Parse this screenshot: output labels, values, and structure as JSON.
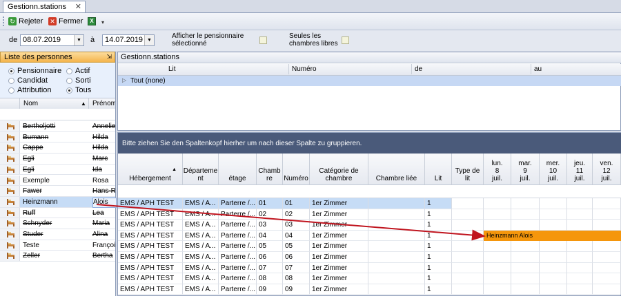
{
  "tab": {
    "title": "Gestionn.stations"
  },
  "toolbar": {
    "reject_label": "Rejeter",
    "close_label": "Fermer"
  },
  "filter": {
    "from_label": "de",
    "from_date": "08.07.2019",
    "to_label": "à",
    "to_date": "14.07.2019",
    "show_selected_label_1": "Afficher le pensionnaire",
    "show_selected_label_2": "sélectionné",
    "free_rooms_label_1": "Seules les",
    "free_rooms_label_2": "chambres libres"
  },
  "persons_panel": {
    "title": "Liste des personnes",
    "radios": [
      {
        "label": "Pensionnaire",
        "checked": true
      },
      {
        "label": "Actif",
        "checked": false
      },
      {
        "label": "Candidat",
        "checked": false
      },
      {
        "label": "Sorti",
        "checked": false
      },
      {
        "label": "Attribution",
        "checked": false
      },
      {
        "label": "Tous",
        "checked": true
      }
    ],
    "col_name": "Nom",
    "col_first": "Prénom",
    "rows": [
      {
        "name": "Bertholjotti",
        "first": "Anneliese",
        "struck": true
      },
      {
        "name": "Bumann",
        "first": "Hilda",
        "struck": true
      },
      {
        "name": "Cappe",
        "first": "Hilda",
        "struck": true
      },
      {
        "name": "Egli",
        "first": "Marc",
        "struck": true
      },
      {
        "name": "Egli",
        "first": "Ida",
        "struck": true
      },
      {
        "name": "Exemple",
        "first": "Rosa",
        "struck": false
      },
      {
        "name": "Fawer",
        "first": "Hans-Rudolf",
        "struck": true
      },
      {
        "name": "Heinzmann",
        "first": "Alois",
        "struck": false,
        "selected": true
      },
      {
        "name": "Ruff",
        "first": "Lea",
        "struck": true
      },
      {
        "name": "Schnyder",
        "first": "Maria",
        "struck": true
      },
      {
        "name": "Studer",
        "first": "Alina",
        "struck": true
      },
      {
        "name": "Teste",
        "first": "François",
        "struck": false
      },
      {
        "name": "Zeller",
        "first": "Bertha",
        "struck": true
      }
    ]
  },
  "stations_top": {
    "title": "Gestionn.stations",
    "cols": [
      "Lit",
      "Numéro",
      "de",
      "au"
    ],
    "group_row": "Tout  (none)"
  },
  "grid": {
    "group_hint": "Bitte ziehen Sie den Spaltenkopf hierher um nach dieser Spalte zu gruppieren.",
    "headers": [
      "Hébergement",
      "Départeme\nnt",
      "étage",
      "Chamb\nre",
      "Numéro",
      "Catégorie de\nchambre",
      "Chambre liée",
      "Lit",
      "Type de\nlit",
      "lun.\n8\njuil.",
      "mar.\n9\njuil.",
      "mer.\n10\njuil.",
      "jeu.\n11\njuil.",
      "ven.\n12\njuil."
    ],
    "rows": [
      [
        "EMS / APH TEST",
        "EMS / A...",
        "Parterre /...",
        "01",
        "01",
        "1er Zimmer",
        "",
        "1"
      ],
      [
        "EMS / APH TEST",
        "EMS / A...",
        "Parterre /...",
        "02",
        "02",
        "1er Zimmer",
        "",
        "1"
      ],
      [
        "EMS / APH TEST",
        "EMS / A...",
        "Parterre /...",
        "03",
        "03",
        "1er Zimmer",
        "",
        "1"
      ],
      [
        "EMS / APH TEST",
        "EMS / A...",
        "Parterre /...",
        "04",
        "04",
        "1er Zimmer",
        "",
        "1"
      ],
      [
        "EMS / APH TEST",
        "EMS / A...",
        "Parterre /...",
        "05",
        "05",
        "1er Zimmer",
        "",
        "1"
      ],
      [
        "EMS / APH TEST",
        "EMS / A...",
        "Parterre /...",
        "06",
        "06",
        "1er Zimmer",
        "",
        "1"
      ],
      [
        "EMS / APH TEST",
        "EMS / A...",
        "Parterre /...",
        "07",
        "07",
        "1er Zimmer",
        "",
        "1"
      ],
      [
        "EMS / APH TEST",
        "EMS / A...",
        "Parterre /...",
        "08",
        "08",
        "1er Zimmer",
        "",
        "1"
      ],
      [
        "EMS / APH TEST",
        "EMS / A...",
        "Parterre /...",
        "09",
        "09",
        "1er Zimmer",
        "",
        "1"
      ]
    ],
    "booking": {
      "label": "Heinzmann Alois",
      "row": 3,
      "start_day": 0,
      "color": "#f5960c"
    }
  },
  "colors": {
    "header_orange": "#f4b44c",
    "selection": "#c6dcf6",
    "group_bar": "#4a5a7a",
    "arrow": "#c0141e"
  }
}
